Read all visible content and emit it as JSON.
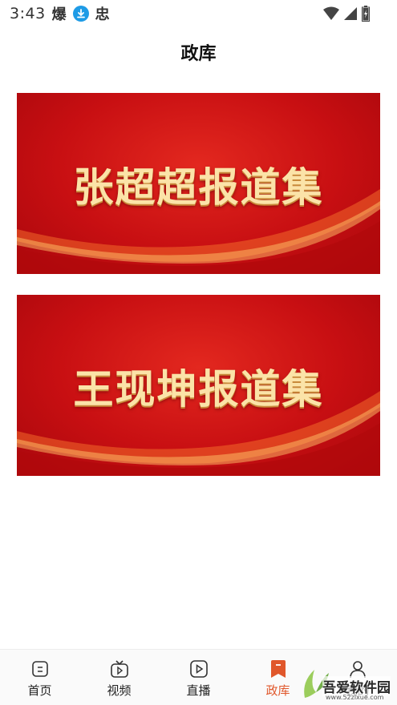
{
  "status_bar": {
    "time": "3:43",
    "app_icon_1": "爆",
    "app_icon_2": "忠"
  },
  "header": {
    "title": "政库"
  },
  "banners": [
    {
      "text": "张超超报道集"
    },
    {
      "text": "王现坤报道集"
    }
  ],
  "bottom_nav": {
    "items": [
      {
        "label": "首页",
        "icon": "home-doc-icon"
      },
      {
        "label": "视频",
        "icon": "tv-icon"
      },
      {
        "label": "直播",
        "icon": "play-icon"
      },
      {
        "label": "政库",
        "icon": "bookmark-icon"
      },
      {
        "label": "我的",
        "icon": "user-icon"
      }
    ],
    "active_index": 3
  },
  "watermark": {
    "text": "吾爱软件园",
    "url": "www.52zixue.com"
  },
  "colors": {
    "accent": "#e0572b",
    "banner_red": "#c80f12",
    "banner_gold": "#fbe3a8",
    "download_blue": "#1e9be6"
  }
}
